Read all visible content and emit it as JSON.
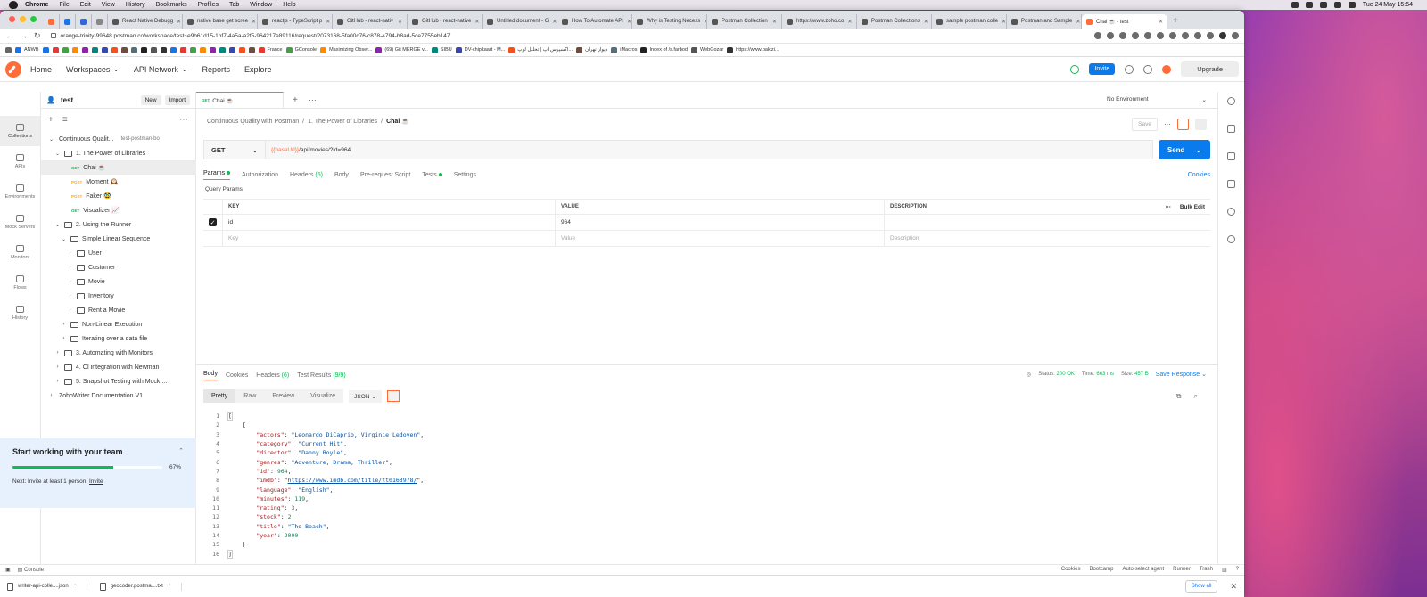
{
  "menubar": {
    "app": "Chrome",
    "items": [
      "File",
      "Edit",
      "View",
      "History",
      "Bookmarks",
      "Profiles",
      "Tab",
      "Window",
      "Help"
    ],
    "clock": "Tue 24 May  15:54"
  },
  "browser_tabs": [
    "React Native Debugg",
    "native base get scree",
    "reactjs - TypeScript p",
    "GitHub - react-nativ",
    "GitHub - react-native",
    "Untitled document - G",
    "How To Automate API",
    "Why is Testing Necess",
    "Postman Collection",
    "https://www.zoho.co",
    "Postman Collections",
    "sample postman colle",
    "Postman and Sample",
    "Chai ☕ - test"
  ],
  "url": "orange-trinity-99648.postman.co/workspace/test~e9b61d15-1bf7-4a5a-a2f5-964217e89116/request/2073168-5fa00c76-c878-4794-b8ad-5ce7755eb147",
  "bookmarks": [
    "ANWB",
    "France",
    "GConsole",
    "Maximizing Obser...",
    "(69) Git MERGE v...",
    "SIBU",
    "DV-chipkaart - M...",
    "اکسپرس اپ | تحلیل لوپ...",
    "دیوار تهران",
    "iMacros",
    "Index of /s.farbod",
    "WebGozar",
    "https://www.pakizi..."
  ],
  "header": {
    "nav": [
      "Home",
      "Workspaces",
      "API Network",
      "Reports",
      "Explore"
    ],
    "search": "Search Postman",
    "invite": "Invite",
    "upgrade": "Upgrade"
  },
  "rail": [
    "Collections",
    "APIs",
    "Environments",
    "Mock Servers",
    "Monitors",
    "Flows",
    "History"
  ],
  "sidebar": {
    "workspace": "test",
    "new": "New",
    "import": "Import"
  },
  "tree": [
    {
      "label": "Continuous Qualit...",
      "extra": "test-postman-bo",
      "level": 0,
      "chev": "⌄",
      "type": "coll"
    },
    {
      "label": "1. The Power of Libraries",
      "level": 1,
      "chev": "⌄",
      "type": "folder"
    },
    {
      "label": "Chai ☕",
      "level": 2,
      "method": "GET",
      "type": "req",
      "sel": true
    },
    {
      "label": "Moment 🕰️",
      "level": 2,
      "method": "POST",
      "type": "req"
    },
    {
      "label": "Faker 🥸",
      "level": 2,
      "method": "POST",
      "type": "req"
    },
    {
      "label": "Visualizer 📈",
      "level": 2,
      "method": "GET",
      "type": "req"
    },
    {
      "label": "2. Using the Runner",
      "level": 1,
      "chev": "⌄",
      "type": "folder"
    },
    {
      "label": "Simple Linear Sequence",
      "level": 2,
      "chev": "⌄",
      "type": "folder"
    },
    {
      "label": "User",
      "level": 3,
      "chev": "›",
      "type": "folder"
    },
    {
      "label": "Customer",
      "level": 3,
      "chev": "›",
      "type": "folder"
    },
    {
      "label": "Movie",
      "level": 3,
      "chev": "›",
      "type": "folder"
    },
    {
      "label": "Inventory",
      "level": 3,
      "chev": "›",
      "type": "folder"
    },
    {
      "label": "Rent a Movie",
      "level": 3,
      "chev": "›",
      "type": "folder"
    },
    {
      "label": "Non-Linear Execution",
      "level": 2,
      "chev": "›",
      "type": "folder"
    },
    {
      "label": "Iterating over a data file",
      "level": 2,
      "chev": "›",
      "type": "folder"
    },
    {
      "label": "3. Automating with Monitors",
      "level": 1,
      "chev": "›",
      "type": "folder"
    },
    {
      "label": "4. CI integration with Newman",
      "level": 1,
      "chev": "›",
      "type": "folder"
    },
    {
      "label": "5. Snapshot Testing with Mock ...",
      "level": 1,
      "chev": "›",
      "type": "folder"
    },
    {
      "label": "ZohoWriter Documentation V1",
      "level": 0,
      "chev": "›",
      "type": "coll"
    }
  ],
  "team": {
    "title": "Start working with your team",
    "progress": 67,
    "pct": "67%",
    "next": "Next: Invite at least 1 person.",
    "link": "Invite"
  },
  "request": {
    "tab": "Chai ☕",
    "tab_method": "GET",
    "environment": "No Environment",
    "breadcrumb": [
      "Continuous Quality with Postman",
      "1. The Power of Libraries",
      "Chai ☕"
    ],
    "save": "Save",
    "method": "GET",
    "url_var": "{{baseUrl}}",
    "url_path": "/api/movies/?id=964",
    "send": "Send",
    "tabs": [
      "Params",
      "Authorization",
      "Headers",
      "Body",
      "Pre-request Script",
      "Tests",
      "Settings"
    ],
    "headers_count": "(5)",
    "cookies": "Cookies",
    "query_params": "Query Params",
    "columns": [
      "KEY",
      "VALUE",
      "DESCRIPTION"
    ],
    "bulk": "Bulk Edit",
    "param": {
      "key": "id",
      "value": "964"
    },
    "placeholders": {
      "key": "Key",
      "value": "Value",
      "desc": "Description"
    }
  },
  "response": {
    "tabs": [
      "Body",
      "Cookies",
      "Headers",
      "Test Results"
    ],
    "headers_count": "(6)",
    "tests_count": "(9/9)",
    "status": "200 OK",
    "time": "663 ms",
    "size": "457 B",
    "status_label": "Status:",
    "time_label": "Time:",
    "size_label": "Size:",
    "save": "Save Response",
    "formats": [
      "Pretty",
      "Raw",
      "Preview",
      "Visualize"
    ],
    "lang": "JSON",
    "json": [
      {
        "k": "actors",
        "v": "\"Leonardo DiCaprio, Virginie Ledoyen\"",
        "t": "s"
      },
      {
        "k": "category",
        "v": "\"Current Hit\"",
        "t": "s"
      },
      {
        "k": "director",
        "v": "\"Danny Boyle\"",
        "t": "s"
      },
      {
        "k": "genres",
        "v": "\"Adventure, Drama, Thriller\"",
        "t": "s"
      },
      {
        "k": "id",
        "v": "964",
        "t": "n"
      },
      {
        "k": "imdb",
        "v": "https://www.imdb.com/title/tt0163978/",
        "t": "l"
      },
      {
        "k": "language",
        "v": "\"English\"",
        "t": "s"
      },
      {
        "k": "minutes",
        "v": "119",
        "t": "n"
      },
      {
        "k": "rating",
        "v": "3",
        "t": "n"
      },
      {
        "k": "stock",
        "v": "2",
        "t": "n"
      },
      {
        "k": "title",
        "v": "\"The Beach\"",
        "t": "s"
      },
      {
        "k": "year",
        "v": "2000",
        "t": "n"
      }
    ]
  },
  "footer": {
    "console": "Console",
    "right": [
      "Cookies",
      "Bootcamp",
      "Auto-select agent",
      "Runner",
      "Trash"
    ]
  },
  "downloads": {
    "files": [
      "writer-api-colle....json",
      "geocoder.postma....txt"
    ],
    "show_all": "Show all"
  },
  "colors": {
    "accent": "#ff6c37",
    "primary": "#097bed",
    "success": "#0cbb52"
  }
}
